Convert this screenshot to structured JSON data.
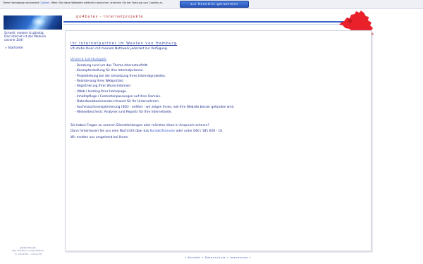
{
  "cookie_bar": {
    "text_before": "Diese Homepage verwendet ",
    "link_label": "Cookies",
    "text_after": ". Wenn Sie diese Webseite weiterhin besuchen, stimmen Sie der Nutzung von Cookies zu.",
    "button_label": "zur Kenntnis genommen"
  },
  "sidebar": {
    "tagline_lines": [
      "Schnell, modern & günstig.",
      "Das Internet ist das Medium",
      "unserer Zeit!"
    ],
    "nav_link": "» Startseite",
    "footer_lines": [
      "go4bytes.de,",
      "das Hinzblur vorbehalten.",
      "© 2002/03 - 2013/25"
    ]
  },
  "header": {
    "site_title": "go4bytes - Internetprojekte"
  },
  "content": {
    "headline": "Ihr Internetpartner im Westen von Hamburg",
    "intro": "Ich stehe Ihnen mit meinem Netzwerk jederzeit zur Verfügung.",
    "services_heading": "Unsere Leistungen",
    "services": [
      "- Beratung rund um das Thema Internetauftritt.",
      "- Konzepterstellung für Ihre Internetpräsenz.",
      "- Projektleitung bei der Umsetzung Ihres Internetprojektes.",
      "- Realisierung Ihres Webportals.",
      "- Registrierung Ihrer Wunschdomain",
      "- (Web-) Hosting Ihrer Homepage.",
      "- Inhaltspflege / Contentanpassungen auf Ihrer Domain.",
      "- Datenbankbasierendes Intranet für Ihr Unternehmen.",
      "- Suchmaschinenoptimierung (SEO - onSite) - wir zeigen Ihnen, wie Ihre Website besser gefunden wird.",
      "- Webseitencheck: Analysen und Reports für Ihre Internetseite."
    ],
    "question": "Sie haben Fragen zu unseren Dienstleistungen oder möchten diese in Anspruch nehmen?",
    "contact_before": "Dann hinterlassen Sie uns eine Nachricht über das ",
    "contact_link": "Kontaktformular",
    "contact_after": " oder unter 040 / 181 626 - 10.",
    "closing": "Wir melden uns umgehend bei Ihnen."
  },
  "bottom_nav": {
    "sep": "•",
    "items": [
      "Kontakt",
      "Datenschutz",
      "Impressum"
    ]
  },
  "colors": {
    "accent": "#3a64c8",
    "title_red": "#b03030",
    "map_red": "#e8212b",
    "text_blue": "#1a2a8a"
  },
  "icons": {
    "map": "hamburg-map-icon"
  }
}
